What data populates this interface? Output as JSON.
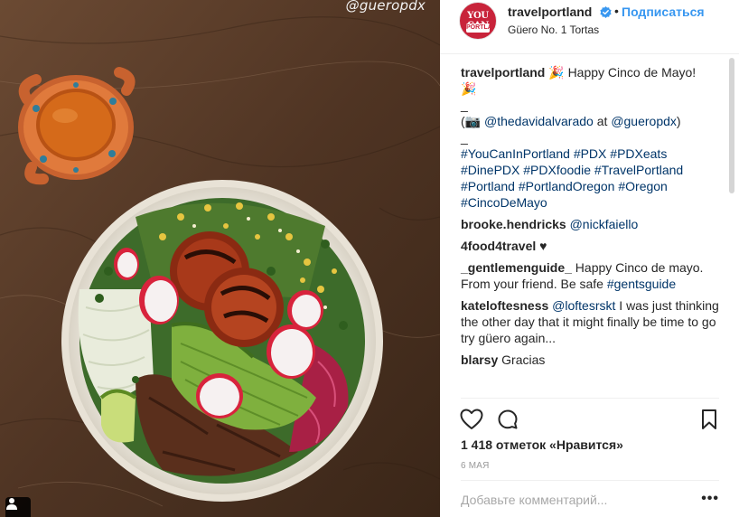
{
  "photo": {
    "watermark": "@gueropdx",
    "user_tag_icon": "person-icon"
  },
  "header": {
    "avatar_text_top": "YOU CAN",
    "avatar_text_bottom": "PORTLAND",
    "username": "travelportland",
    "verified_icon": "verified-badge-icon",
    "dot": "•",
    "follow_label": "Подписаться",
    "location": "Güero No. 1 Tortas"
  },
  "caption": {
    "username": "travelportland",
    "line1": " 🎉 Happy Cinco de Mayo!",
    "line2": "🎉",
    "line3": "_",
    "credit_prefix": "(📷 ",
    "credit_user": "@thedavidalvarado",
    "credit_mid": " at ",
    "credit_place": "@gueropdx",
    "credit_suffix": ")",
    "line5": "_",
    "hashtags": [
      "#YouCanInPortland",
      "#PDX",
      "#PDXeats",
      "#DinePDX",
      "#PDXfoodie",
      "#TravelPortland",
      "#Portland",
      "#PortlandOregon",
      "#Oregon",
      "#CincoDeMayo"
    ]
  },
  "comments": [
    {
      "user": "brooke.hendricks",
      "text": "",
      "mention": "@nickfaiello",
      "after": ""
    },
    {
      "user": "4food4travel",
      "text": " ♥",
      "mention": "",
      "after": ""
    },
    {
      "user": "_gentlemenguide_",
      "text": " Happy Cinco de mayo. From your friend. Be safe ",
      "mention": "#gentsguide",
      "after": ""
    },
    {
      "user": "kateloftesness",
      "text": " ",
      "mention": "@loftesrskt",
      "after": " I was just thinking the other day that it might finally be time to go try güero again..."
    },
    {
      "user": "blarsy",
      "text": " Gracias",
      "mention": "",
      "after": ""
    }
  ],
  "actions": {
    "like_icon": "heart-icon",
    "comment_icon": "comment-bubble-icon",
    "save_icon": "bookmark-icon"
  },
  "likes_text": "1 418 отметок «Нравится»",
  "date": "6 мая",
  "comment_box": {
    "placeholder": "Добавьте комментарий...",
    "more_label": "•••"
  },
  "colors": {
    "link": "#003569",
    "follow": "#3897f0",
    "verified": "#3897f0",
    "avatar_bg": "#c8233a"
  }
}
